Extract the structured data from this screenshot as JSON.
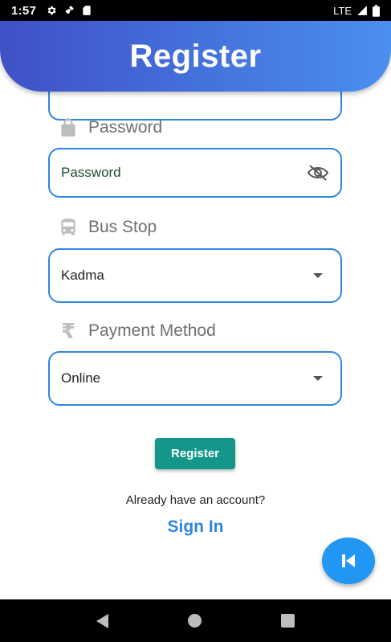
{
  "status_bar": {
    "time": "1:57",
    "network": "LTE",
    "icons": [
      "gear-icon",
      "satellite-icon",
      "sd-card-icon",
      "signal-icon",
      "battery-icon"
    ]
  },
  "header": {
    "title": "Register"
  },
  "password_section": {
    "label": "Password",
    "icon": "lock-icon",
    "placeholder": "Password",
    "trailing_icon": "eye-off-icon"
  },
  "bus_stop_section": {
    "label": "Bus Stop",
    "icon": "bus-icon",
    "selected": "Kadma"
  },
  "payment_section": {
    "label": "Payment Method",
    "icon": "rupee-icon",
    "selected": "Online"
  },
  "actions": {
    "register_label": "Register",
    "already_text": "Already have an account?",
    "signin_label": "Sign In"
  },
  "fab": {
    "icon": "skip-previous-icon"
  },
  "colors": {
    "accent": "#2f86e0",
    "button": "#14978a",
    "fab": "#2196f3",
    "header_start": "#3f51c5",
    "header_end": "#4a8ff0"
  }
}
